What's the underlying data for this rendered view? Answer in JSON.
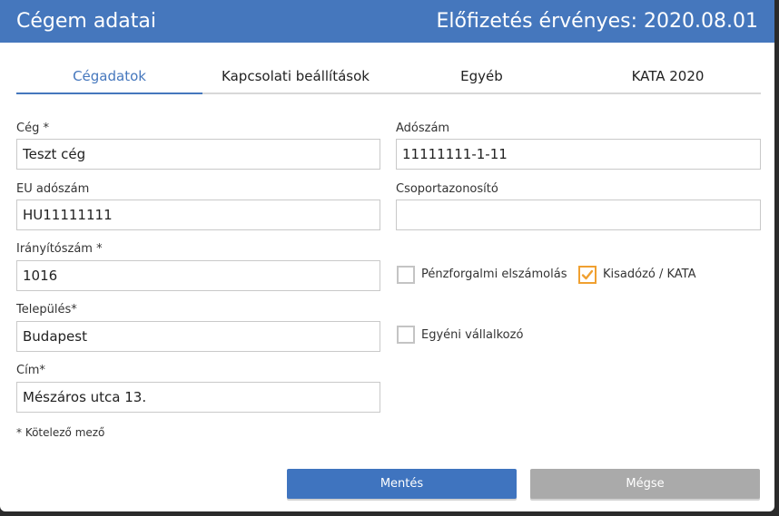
{
  "dialog": {
    "title": "Cégem adatai",
    "subscription": "Előfizetés érvényes: 2020.08.01"
  },
  "tabs": [
    {
      "label": "Cégadatok",
      "active": true
    },
    {
      "label": "Kapcsolati beállítások",
      "active": false
    },
    {
      "label": "Egyéb",
      "active": false
    },
    {
      "label": "KATA 2020",
      "active": false
    }
  ],
  "form": {
    "company": {
      "label": "Cég *",
      "value": "Teszt cég"
    },
    "tax_number": {
      "label": "Adószám",
      "value": "11111111-1-11"
    },
    "eu_tax_number": {
      "label": "EU adószám",
      "value": "HU11111111"
    },
    "group_id": {
      "label": "Csoportazonosító",
      "value": ""
    },
    "postal_code": {
      "label": "Irányítószám *",
      "value": "1016"
    },
    "city": {
      "label": "Település*",
      "value": "Budapest"
    },
    "address": {
      "label": "Cím*",
      "value": "Mészáros utca 13."
    },
    "cash_accounting": {
      "label": "Pénzforgalmi elszámolás",
      "checked": false
    },
    "kata": {
      "label": "Kisadózó / KATA",
      "checked": true
    },
    "sole_trader": {
      "label": "Egyéni vállalkozó",
      "checked": false
    },
    "required_note": "* Kötelező mező"
  },
  "buttons": {
    "save": "Mentés",
    "cancel": "Mégse"
  },
  "colors": {
    "header": "#4577bd",
    "accent": "#4577bd",
    "checkbox_checked": "#f0a030",
    "save_button": "#3f74bf",
    "cancel_button": "#aaaaaa"
  }
}
